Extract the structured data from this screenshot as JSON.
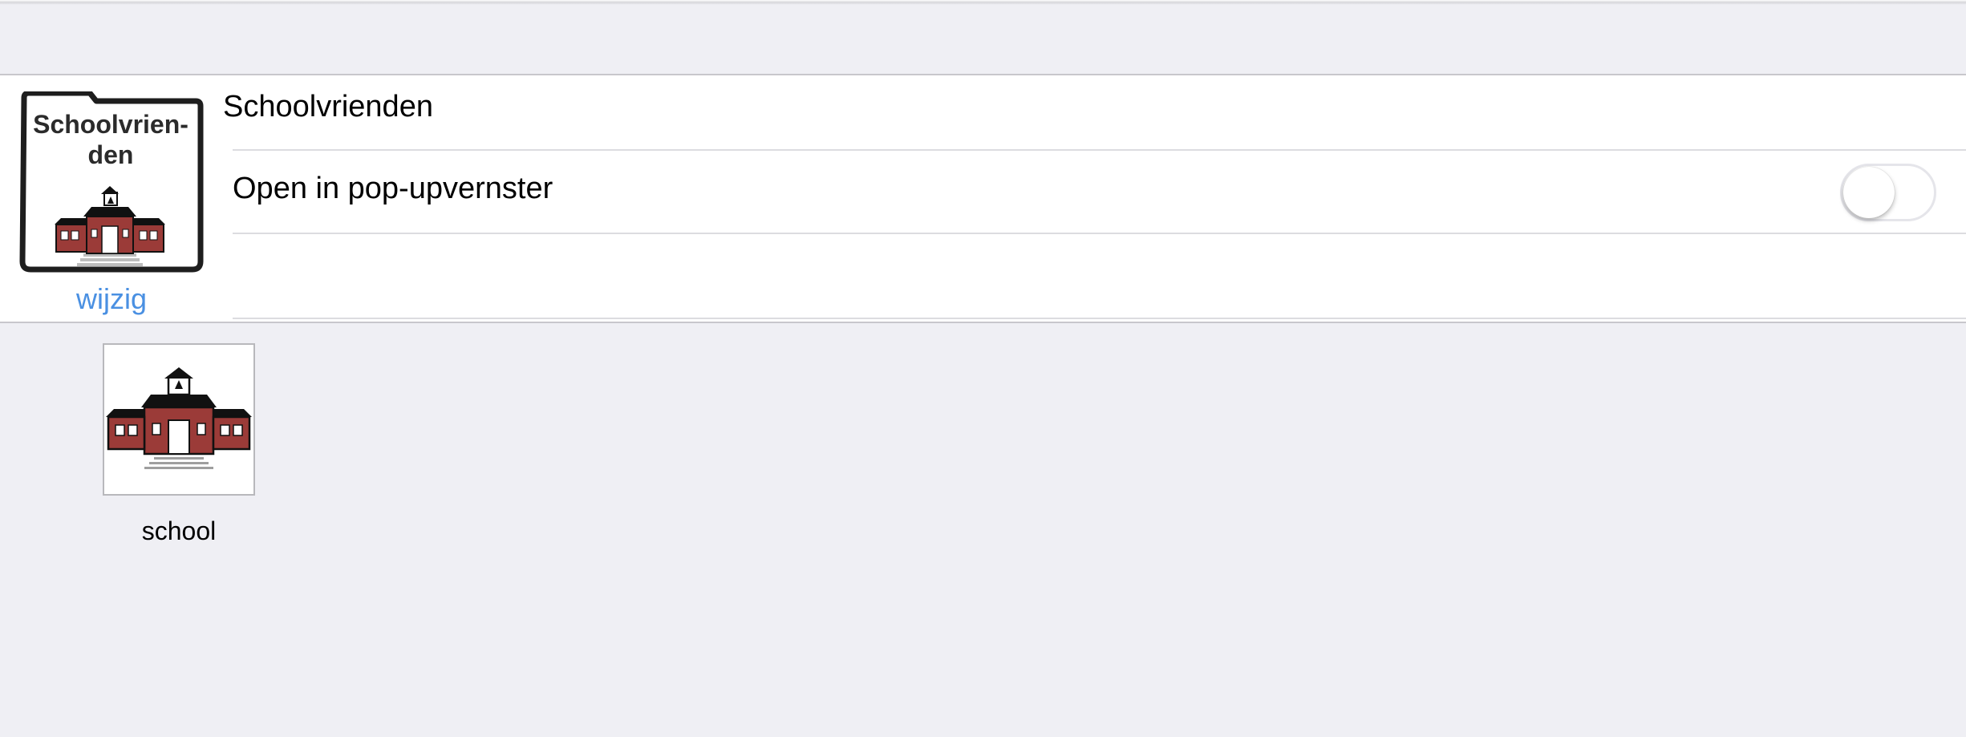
{
  "folder": {
    "name": "Schoolvrienden",
    "icon_label": "Schoolvrien-den",
    "icon_label_lines": [
      "Schoolvrien-",
      "den"
    ],
    "edit_label": "wijzig"
  },
  "settings": {
    "popup_label": "Open in pop-upvernster",
    "popup_enabled": false
  },
  "items": [
    {
      "label": "school",
      "icon": "school-building-icon"
    }
  ],
  "colors": {
    "background": "#efeff4",
    "link": "#4a90e2",
    "building": "#9b3b38",
    "roof": "#111111"
  }
}
